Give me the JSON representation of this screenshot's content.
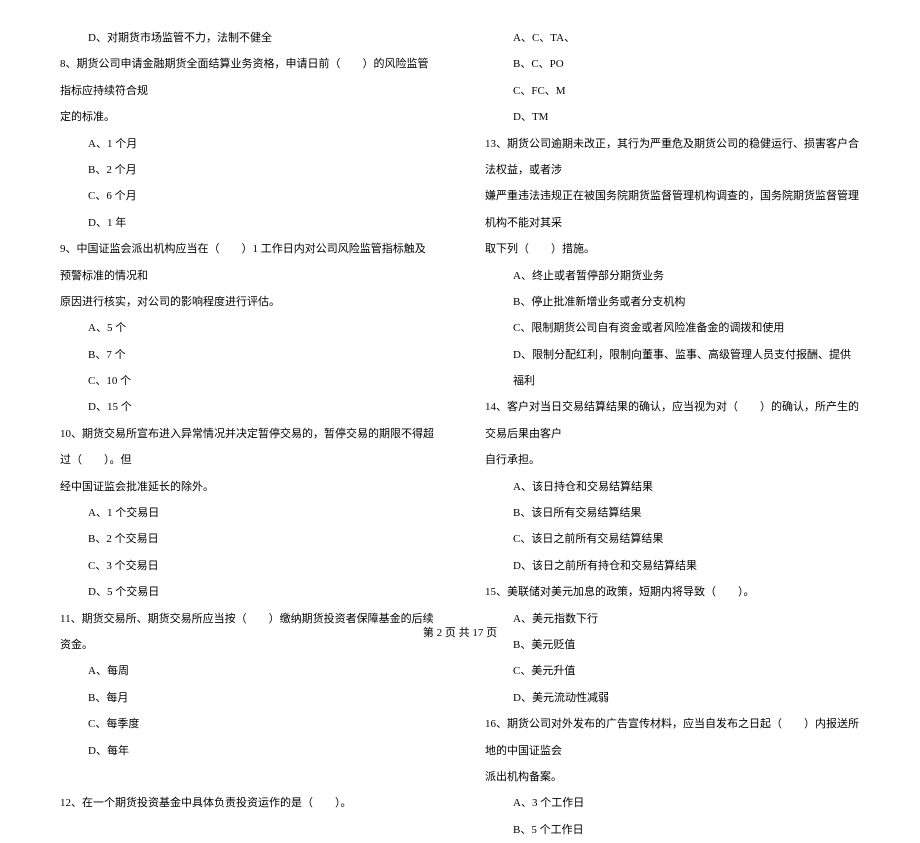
{
  "left_column": [
    {
      "type": "option",
      "text": "D、对期货市场监管不力，法制不健全"
    },
    {
      "type": "question",
      "text": "8、期货公司申请金融期货全面结算业务资格，申请日前（　　）的风险监管指标应持续符合规"
    },
    {
      "type": "question",
      "text": "定的标准。"
    },
    {
      "type": "option",
      "text": "A、1 个月"
    },
    {
      "type": "option",
      "text": "B、2 个月"
    },
    {
      "type": "option",
      "text": "C、6 个月"
    },
    {
      "type": "option",
      "text": "D、1 年"
    },
    {
      "type": "question",
      "text": "9、中国证监会派出机构应当在（　　）1 工作日内对公司风险监管指标触及预警标准的情况和"
    },
    {
      "type": "question",
      "text": "原因进行核实，对公司的影响程度进行评估。"
    },
    {
      "type": "option",
      "text": "A、5 个"
    },
    {
      "type": "option",
      "text": "B、7 个"
    },
    {
      "type": "option",
      "text": "C、10 个"
    },
    {
      "type": "option",
      "text": "D、15 个"
    },
    {
      "type": "question",
      "text": "10、期货交易所宣布进入异常情况并决定暂停交易的，暂停交易的期限不得超过（　　）。但"
    },
    {
      "type": "question",
      "text": "经中国证监会批准延长的除外。"
    },
    {
      "type": "option",
      "text": "A、1 个交易日"
    },
    {
      "type": "option",
      "text": "B、2 个交易日"
    },
    {
      "type": "option",
      "text": "C、3 个交易日"
    },
    {
      "type": "option",
      "text": "D、5 个交易日"
    },
    {
      "type": "question",
      "text": "11、期货交易所、期货交易所应当按（　　）缴纳期货投资者保障基金的后续资金。"
    },
    {
      "type": "option",
      "text": "A、每周"
    },
    {
      "type": "option",
      "text": "B、每月"
    },
    {
      "type": "option",
      "text": "C、每季度"
    },
    {
      "type": "option",
      "text": "D、每年"
    },
    {
      "type": "blank",
      "text": ""
    },
    {
      "type": "question",
      "text": "12、在一个期货投资基金中具体负责投资运作的是（　　）。"
    }
  ],
  "right_column": [
    {
      "type": "option",
      "text": "A、C、TA、"
    },
    {
      "type": "option",
      "text": "B、C、PO"
    },
    {
      "type": "option",
      "text": "C、FC、M"
    },
    {
      "type": "option",
      "text": "D、TM"
    },
    {
      "type": "question",
      "text": "13、期货公司逾期未改正，其行为严重危及期货公司的稳健运行、损害客户合法权益，或者涉"
    },
    {
      "type": "question",
      "text": "嫌严重违法违规正在被国务院期货监督管理机构调查的，国务院期货监督管理机构不能对其采"
    },
    {
      "type": "question",
      "text": "取下列（　　）措施。"
    },
    {
      "type": "option",
      "text": "A、终止或者暂停部分期货业务"
    },
    {
      "type": "option",
      "text": "B、停止批准新增业务或者分支机构"
    },
    {
      "type": "option",
      "text": "C、限制期货公司自有资金或者风险准备金的调拨和使用"
    },
    {
      "type": "option",
      "text": "D、限制分配红利，限制向董事、监事、高级管理人员支付报酬、提供福利"
    },
    {
      "type": "question",
      "text": "14、客户对当日交易结算结果的确认，应当视为对（　　）的确认，所产生的交易后果由客户"
    },
    {
      "type": "question",
      "text": "自行承担。"
    },
    {
      "type": "option",
      "text": "A、该日持仓和交易结算结果"
    },
    {
      "type": "option",
      "text": "B、该日所有交易结算结果"
    },
    {
      "type": "option",
      "text": "C、该日之前所有交易结算结果"
    },
    {
      "type": "option",
      "text": "D、该日之前所有持仓和交易结算结果"
    },
    {
      "type": "question",
      "text": "15、美联储对美元加息的政策，短期内将导致（　　）。"
    },
    {
      "type": "option",
      "text": "A、美元指数下行"
    },
    {
      "type": "option",
      "text": "B、美元贬值"
    },
    {
      "type": "option",
      "text": "C、美元升值"
    },
    {
      "type": "option",
      "text": "D、美元流动性减弱"
    },
    {
      "type": "question",
      "text": "16、期货公司对外发布的广告宣传材料，应当自发布之日起（　　）内报送所地的中国证监会"
    },
    {
      "type": "question",
      "text": "派出机构备案。"
    },
    {
      "type": "option",
      "text": "A、3 个工作日"
    },
    {
      "type": "option",
      "text": "B、5 个工作日"
    }
  ],
  "footer": "第 2 页 共 17 页"
}
